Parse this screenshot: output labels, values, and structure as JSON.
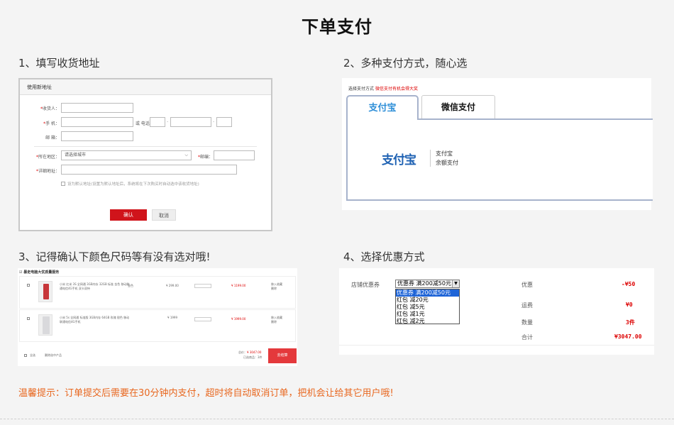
{
  "page_title": "下单支付",
  "steps": [
    {
      "label": "1、填写收货地址"
    },
    {
      "label": "2、多种支付方式，随心选"
    },
    {
      "label": "3、记得确认下颜色尺码等有没有选对哦!"
    },
    {
      "label": "4、选择优惠方式"
    }
  ],
  "address_form": {
    "header": "使用新地址",
    "receiver_label": "收货人：",
    "mobile_label": "手    机：",
    "phone_or": "或 电话",
    "email_label": "邮    箱：",
    "region_label": "所在地区：",
    "region_placeholder": "请选择城市",
    "zip_label": "邮编：",
    "detail_label": "详细地址：",
    "default_checkbox": "设为默认地址(设置为默认地址后，系统将在下次购买时自动选中该收货地址)",
    "confirm_button": "确认",
    "cancel_button": "取消"
  },
  "payment": {
    "header": "选择支付方式",
    "header_promo": "微信支付有机会得大奖",
    "tab_alipay": "支付宝",
    "tab_wechat": "微信支付",
    "alipay_logo": "支付宝",
    "alipay_name": "支付宝",
    "alipay_sub": "余额支付",
    "accent_color": "#2f8fd8",
    "brand_blue": "#1f62b3"
  },
  "cart": {
    "header": "暴走电脑大优质量服务",
    "items": [
      {
        "desc": "小米 红米 3S 全网通 3GB内存 32GB 标准 金色 移动联通电信4G手机 双卡双待",
        "color": "金色",
        "price": "¥ 299.00",
        "subtotal": "¥ 1199.00",
        "actions": "移入收藏 删除"
      },
      {
        "desc": "小米 5s 全网通 标准版 3GB内存 64GB 玫瑰 银色 移动联通电信4G手机",
        "color": "",
        "price": "¥ 1999",
        "subtotal": "¥ 1999.00",
        "actions": "移入收藏 删除"
      }
    ],
    "footer_select_all": "全选",
    "footer_delete": "删除选中产品",
    "total_label": "总价：",
    "total_value": "¥ 3047.00",
    "selected_label": "已选商品：",
    "selected_count": "3件",
    "checkout_button": "去结算"
  },
  "coupon": {
    "store_coupon_label": "店铺优惠券",
    "selected": "优惠券 满200减50元",
    "options": [
      "优惠券 满200减50元",
      "红包 减20元",
      "红包 减5元",
      "红包 减1元",
      "红包 减2元"
    ],
    "discount_label": "优惠",
    "discount_value": "-¥50",
    "shipping_label": "运费",
    "shipping_value": "¥0",
    "qty_label": "数量",
    "qty_value": "3件",
    "total_label": "合计",
    "total_value": "¥3047.00"
  },
  "notice": "温馨提示：订单提交后需要在30分钟内支付，超时将自动取消订单，把机会让给其它用户哦!"
}
